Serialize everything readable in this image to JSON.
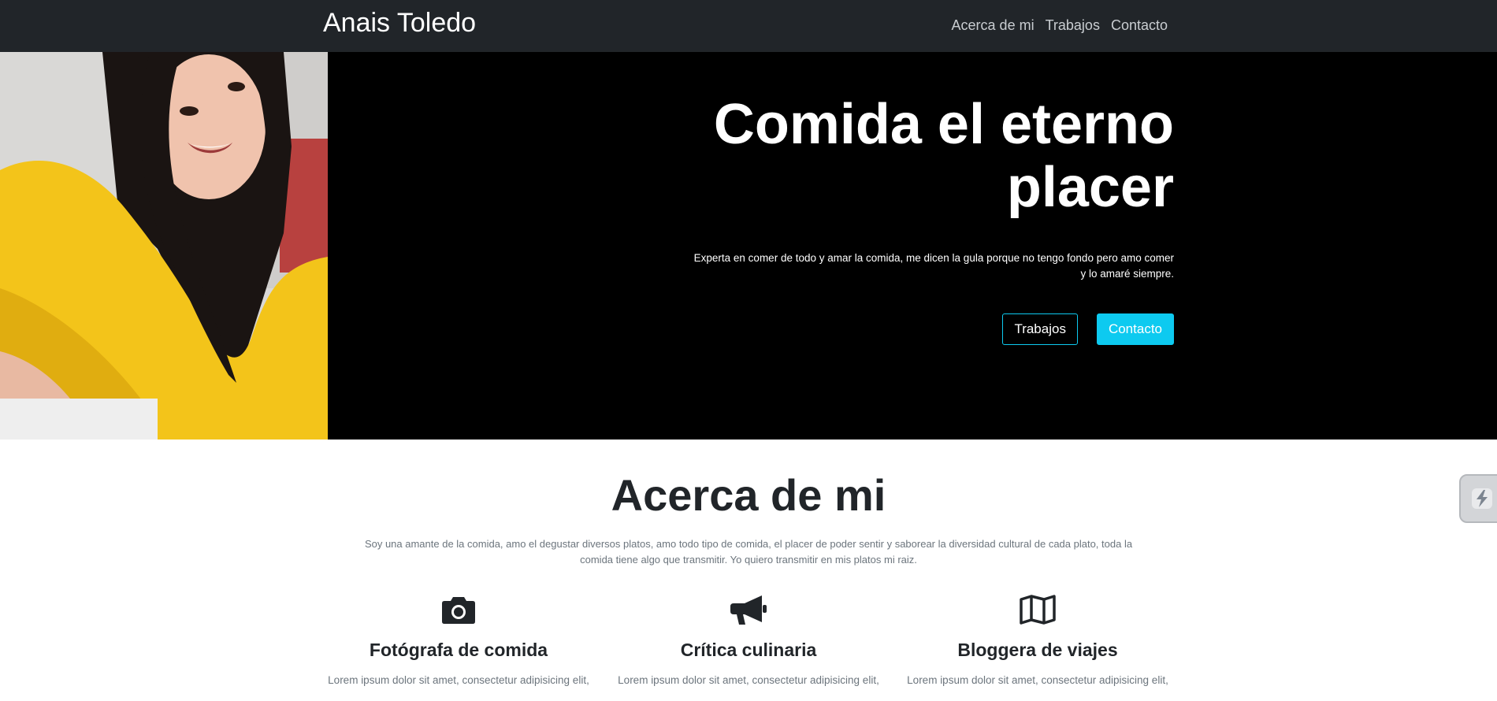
{
  "nav": {
    "brand": "Anais Toledo",
    "links": [
      "Acerca de mi",
      "Trabajos",
      "Contacto"
    ]
  },
  "hero": {
    "title_line1": "Comida el eterno",
    "title_line2": "placer",
    "subtitle_line1": "Experta en comer de todo y amar la comida, me dicen la gula porque no tengo fondo pero amo comer",
    "subtitle_line2": "y lo amaré siempre.",
    "button_outline": "Trabajos",
    "button_solid": "Contacto"
  },
  "about": {
    "title": "Acerca de mi",
    "text_line1": "Soy una amante de la comida, amo el degustar diversos platos, amo todo tipo de comida, el placer de poder sentir y saborear la diversidad cultural de cada plato, toda la",
    "text_line2": "comida tiene algo que transmitir. Yo quiero transmitir en mis platos mi raiz.",
    "features": [
      {
        "icon": "camera-icon",
        "title": "Fotógrafa de comida",
        "text": "Lorem ipsum dolor sit amet, consectetur adipisicing elit,"
      },
      {
        "icon": "megaphone-icon",
        "title": "Crítica culinaria",
        "text": "Lorem ipsum dolor sit amet, consectetur adipisicing elit,"
      },
      {
        "icon": "map-icon",
        "title": "Bloggera de viajes",
        "text": "Lorem ipsum dolor sit amet, consectetur adipisicing elit,"
      }
    ]
  },
  "colors": {
    "navbar": "#212529",
    "accent": "#0dcaf0",
    "hero_bg": "#000000",
    "sweater": "#f3c41a"
  }
}
